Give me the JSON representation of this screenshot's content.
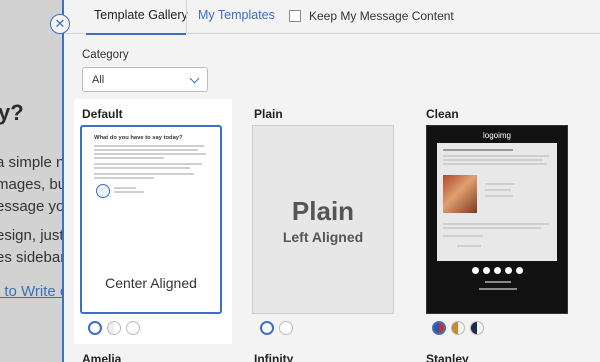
{
  "background": {
    "heading_fragment": "y?",
    "lines": [
      "a simple n",
      "mages, butt",
      "essage you",
      "esign, just",
      "es sidebar",
      "t to Write c"
    ]
  },
  "panel": {
    "close_glyph": "✕",
    "tabs": {
      "gallery": "Template Gallery",
      "my_templates": "My Templates",
      "keep_content": "Keep My Message Content"
    },
    "category": {
      "label": "Category",
      "value": "All"
    },
    "templates": [
      {
        "title": "Default",
        "preview_heading": "What do you have to say today?",
        "preview_label": "Center Aligned",
        "selected": true
      },
      {
        "title": "Plain",
        "preview_big": "Plain",
        "preview_small": "Left Aligned"
      },
      {
        "title": "Clean",
        "logo": "logoimg"
      }
    ],
    "bottom_titles": [
      "Amelia",
      "Infinity",
      "Stanley"
    ]
  },
  "colors": {
    "accent": "#3d6fc4"
  }
}
